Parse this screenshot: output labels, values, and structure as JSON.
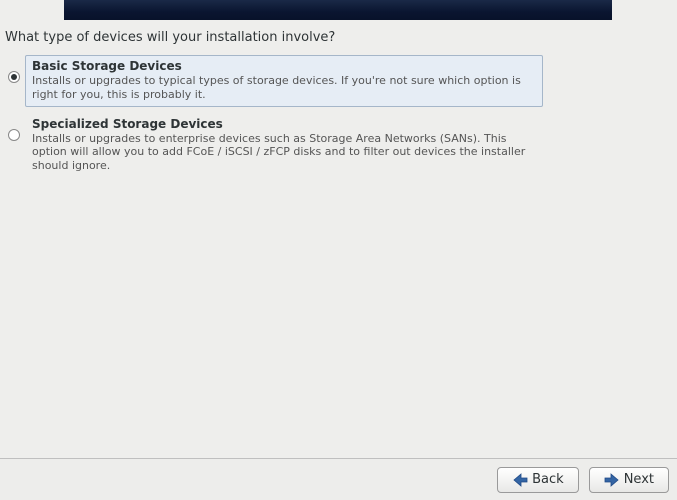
{
  "question": "What type of devices will your installation involve?",
  "options": {
    "basic": {
      "title": "Basic Storage Devices",
      "desc": "Installs or upgrades to typical types of storage devices.  If you're not sure which option is right for you, this is probably it."
    },
    "specialized": {
      "title": "Specialized Storage Devices",
      "desc": "Installs or upgrades to enterprise devices such as Storage Area Networks (SANs). This option will allow you to add FCoE / iSCSI / zFCP disks and to filter out devices the installer should ignore."
    }
  },
  "buttons": {
    "back": "Back",
    "next": "Next"
  }
}
